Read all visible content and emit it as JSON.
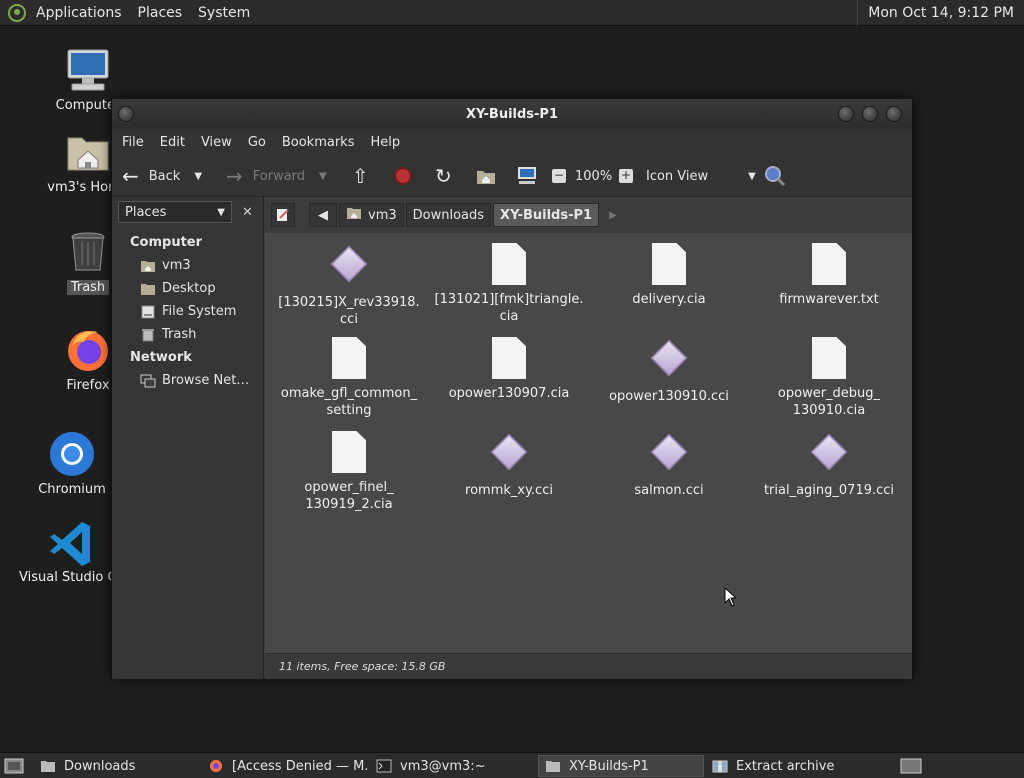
{
  "top_panel": {
    "menus": [
      "Applications",
      "Places",
      "System"
    ],
    "clock": "Mon Oct 14,  9:12 PM"
  },
  "desktop_icons": [
    {
      "label": "Computer",
      "icon": "computer-icon"
    },
    {
      "label": "vm3's Home",
      "icon": "home-folder-icon"
    },
    {
      "label": "Trash",
      "icon": "trash-icon"
    },
    {
      "label": "Firefox",
      "icon": "firefox-icon"
    },
    {
      "label": "Chromium",
      "icon": "chromium-icon"
    },
    {
      "label": "Visual Studio Code",
      "icon": "vscode-icon"
    }
  ],
  "window": {
    "title": "XY-Builds-P1",
    "menu": [
      "File",
      "Edit",
      "View",
      "Go",
      "Bookmarks",
      "Help"
    ],
    "toolbar": {
      "back": "Back",
      "forward": "Forward",
      "zoom": "100%",
      "view_mode": "Icon View"
    },
    "sidebar": {
      "header": "Places",
      "sections": [
        {
          "title": "Computer",
          "items": [
            {
              "label": "vm3",
              "icon": "home-icon"
            },
            {
              "label": "Desktop",
              "icon": "desktop-icon"
            },
            {
              "label": "File System",
              "icon": "drive-icon"
            },
            {
              "label": "Trash",
              "icon": "trash-icon"
            }
          ]
        },
        {
          "title": "Network",
          "items": [
            {
              "label": "Browse Net…",
              "icon": "network-icon"
            }
          ]
        }
      ]
    },
    "breadcrumbs": [
      "vm3",
      "Downloads",
      "XY-Builds-P1"
    ],
    "files": [
      {
        "name": "[130215]X_rev33918.\ncci",
        "type": "cci"
      },
      {
        "name": "[131021][fmk]triangle.\ncia",
        "type": "doc"
      },
      {
        "name": "delivery.cia",
        "type": "doc"
      },
      {
        "name": "firmwarever.txt",
        "type": "doc"
      },
      {
        "name": "omake_gfl_common_\nsetting",
        "type": "doc"
      },
      {
        "name": "opower130907.cia",
        "type": "doc"
      },
      {
        "name": "opower130910.cci",
        "type": "cci"
      },
      {
        "name": "opower_debug_\n130910.cia",
        "type": "doc"
      },
      {
        "name": "opower_finel_\n130919_2.cia",
        "type": "doc"
      },
      {
        "name": "rommk_xy.cci",
        "type": "cci"
      },
      {
        "name": "salmon.cci",
        "type": "cci"
      },
      {
        "name": "trial_aging_0719.cci",
        "type": "cci"
      }
    ],
    "status": "11 items, Free space: 15.8 GB"
  },
  "taskbar": {
    "tasks": [
      {
        "label": "Downloads",
        "icon": "folder-icon"
      },
      {
        "label": "[Access Denied — M...",
        "icon": "firefox-icon"
      },
      {
        "label": "vm3@vm3:~",
        "icon": "terminal-icon"
      },
      {
        "label": "XY-Builds-P1",
        "icon": "folder-icon"
      },
      {
        "label": "Extract archive",
        "icon": "archive-icon"
      }
    ]
  }
}
